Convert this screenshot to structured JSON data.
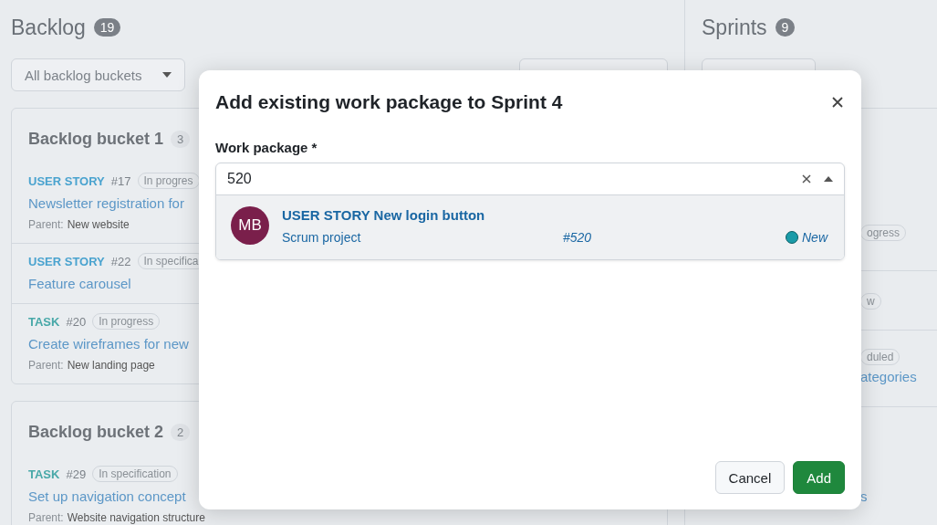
{
  "backlog": {
    "title": "Backlog",
    "count": "19",
    "filter": "All backlog buckets",
    "buckets": [
      {
        "title": "Backlog bucket 1",
        "count": "3",
        "items": [
          {
            "type": "USER STORY",
            "color": "#4aa3cf",
            "number": "#17",
            "status": "In progres",
            "title": "Newsletter registration for",
            "parent_label": "Parent:",
            "parent": "New website"
          },
          {
            "type": "USER STORY",
            "color": "#4aa3cf",
            "number": "#22",
            "status": "In specifica",
            "title": "Feature carousel"
          },
          {
            "type": "TASK",
            "color": "#48a8a8",
            "number": "#20",
            "status": "In progress",
            "title": "Create wireframes for new",
            "parent_label": "Parent:",
            "parent": "New landing page"
          }
        ]
      },
      {
        "title": "Backlog bucket 2",
        "count": "2",
        "items": [
          {
            "type": "TASK",
            "color": "#48a8a8",
            "number": "#29",
            "status": "In specification",
            "title": "Set up navigation concept",
            "parent_label": "Parent:",
            "parent": "Website navigation structure"
          }
        ]
      }
    ]
  },
  "sprints": {
    "title": "Sprints",
    "count": "9",
    "cards": [
      {
        "rows": [
          {
            "status": "ogress"
          },
          {
            "status": "w"
          },
          {
            "status": "duled",
            "title": "ategories"
          }
        ]
      },
      {
        "rows": [
          {
            "title": "s"
          }
        ]
      }
    ]
  },
  "dialog": {
    "title": "Add existing work package to Sprint 4",
    "field_label": "Work package *",
    "value": "520",
    "results": [
      {
        "initials": "MB",
        "title": "USER STORY New login button",
        "project": "Scrum project",
        "number": "#520",
        "status": "New",
        "color": "#1a9ba8",
        "selected": true
      }
    ],
    "buttons": [
      {
        "label": "Cancel",
        "kind": "secondary"
      },
      {
        "label": "Add",
        "kind": "primary"
      }
    ]
  }
}
